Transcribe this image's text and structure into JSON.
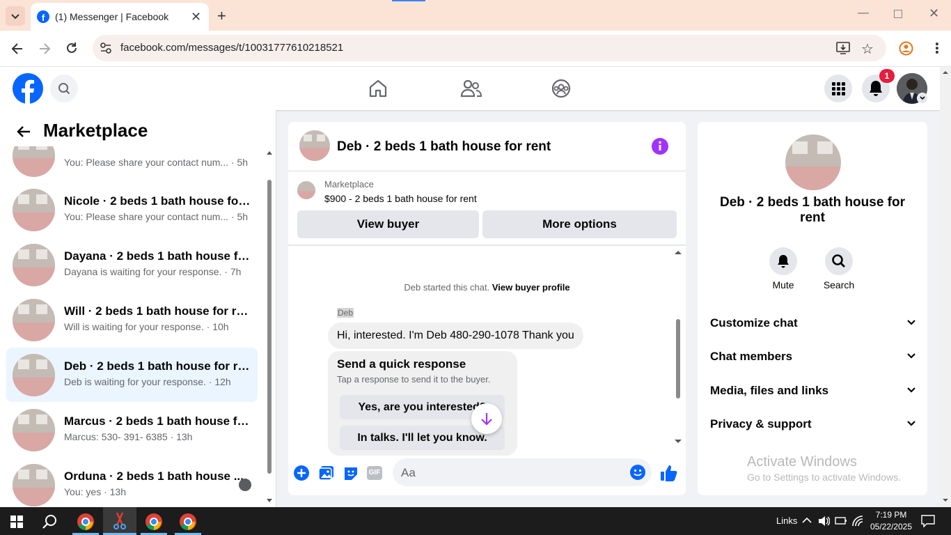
{
  "browser": {
    "tab_title": "(1) Messenger | Facebook",
    "url": "facebook.com/messages/t/10031777610218521"
  },
  "header": {
    "notification_count": "1"
  },
  "left_panel": {
    "title": "Marketplace",
    "conversations": [
      {
        "name": "",
        "snippet": "You: Please share your contact num... · 5h"
      },
      {
        "name": "Nicole · 2 beds 1 bath house for ...",
        "snippet": "You: Please share your contact num... · 5h"
      },
      {
        "name": "Dayana · 2 beds 1 bath house fo...",
        "snippet": "Dayana is waiting for your response. · 7h"
      },
      {
        "name": "Will · 2 beds 1 bath house for rent",
        "snippet": "Will is waiting for your response. · 10h"
      },
      {
        "name": "Deb · 2 beds 1 bath house for rent",
        "snippet": "Deb is waiting for your response. · 12h"
      },
      {
        "name": "Marcus · 2 beds 1 bath house for...",
        "snippet": "Marcus: 530- 391- 6385 · 13h"
      },
      {
        "name": "Orduna · 2 beds 1 bath house ...",
        "snippet": "You: yes · 13h"
      }
    ]
  },
  "chat": {
    "title": "Deb · 2 beds 1 bath house for rent",
    "listing_source": "Marketplace",
    "listing_text": "$900 - 2 beds 1 bath house for rent",
    "view_buyer": "View buyer",
    "more_options": "More options",
    "started_text": "Deb started this chat.",
    "view_buyer_profile": "View buyer profile",
    "sender": "Deb",
    "message": "Hi, interested. I'm Deb 480-290-1078 Thank you",
    "quick_title": "Send a quick response",
    "quick_sub": "Tap a response to send it to the buyer.",
    "quick_options": [
      "Yes, are you interested?",
      "In talks. I'll let you know."
    ],
    "composer_placeholder": "Aa"
  },
  "right_panel": {
    "title": "Deb · 2 beds 1 bath house for rent",
    "mute": "Mute",
    "search": "Search",
    "sections": [
      "Customize chat",
      "Chat members",
      "Media, files and links",
      "Privacy & support"
    ],
    "activate_title": "Activate Windows",
    "activate_sub": "Go to Settings to activate Windows."
  },
  "taskbar": {
    "links": "Links",
    "time": "7:19 PM",
    "date": "05/22/2025"
  },
  "colors": {
    "fb_blue": "#0866ff",
    "messenger_purple": "#a033ff",
    "selected_bg": "#ebf5ff"
  }
}
